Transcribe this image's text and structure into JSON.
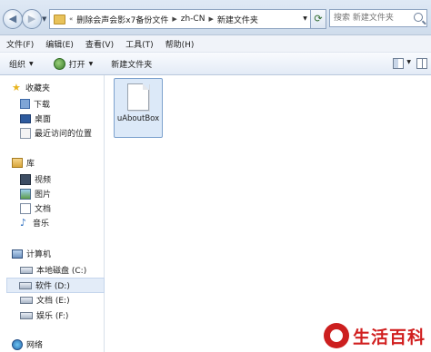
{
  "address": {
    "history_arrow": "«",
    "crumbs": [
      "删除会声会影x7备份文件",
      "zh-CN",
      "新建文件夹"
    ],
    "search_placeholder": "搜索 新建文件夹"
  },
  "menu": [
    "文件(F)",
    "编辑(E)",
    "查看(V)",
    "工具(T)",
    "帮助(H)"
  ],
  "commands": {
    "organize": "组织",
    "open": "打开",
    "new_folder": "新建文件夹"
  },
  "nav": {
    "favorites": {
      "label": "收藏夹",
      "items": [
        "下载",
        "桌面",
        "最近访问的位置"
      ]
    },
    "libraries": {
      "label": "库",
      "items": [
        "视频",
        "图片",
        "文档",
        "音乐"
      ]
    },
    "computer": {
      "label": "计算机",
      "drives": [
        "本地磁盘 (C:)",
        "软件 (D:)",
        "文档 (E:)",
        "娱乐 (F:)"
      ],
      "selected_drive": "软件 (D:)"
    },
    "network": {
      "label": "网络"
    }
  },
  "files": [
    {
      "name": "uAboutBox",
      "type": "file",
      "selected": true
    }
  ],
  "watermark": "生活百科",
  "icons": [
    "back-icon",
    "forward-icon",
    "folder-icon",
    "refresh-icon",
    "search-icon",
    "star-icon",
    "download-icon",
    "desktop-icon",
    "recent-icon",
    "library-icon",
    "video-icon",
    "picture-icon",
    "document-icon",
    "music-icon",
    "computer-icon",
    "drive-icon",
    "network-icon",
    "file-icon"
  ]
}
